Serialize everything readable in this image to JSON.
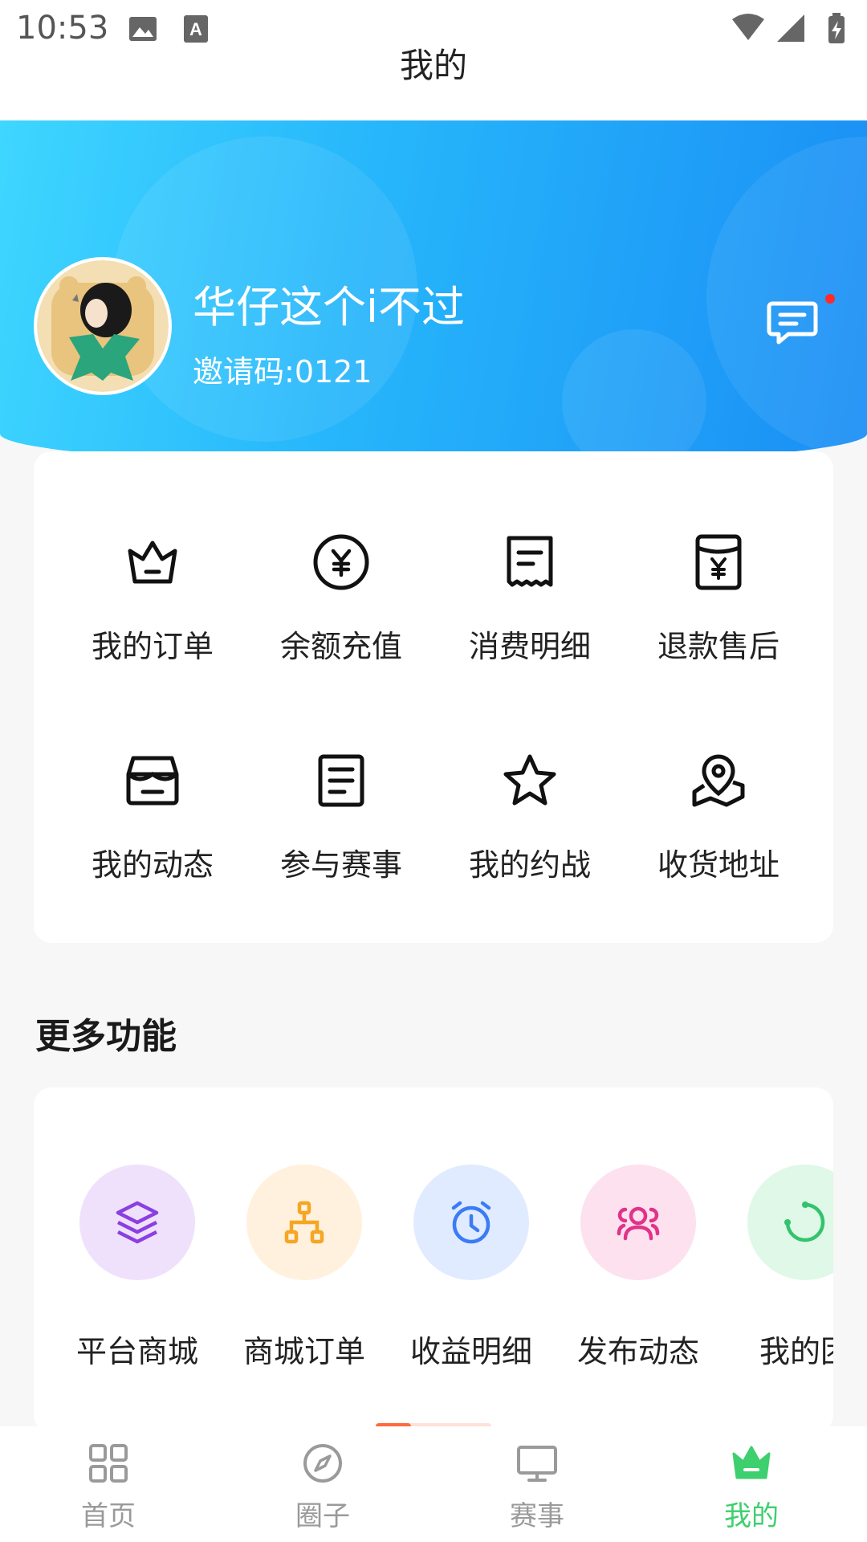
{
  "status_bar": {
    "time": "10:53"
  },
  "header": {
    "title": "我的"
  },
  "profile": {
    "username": "华仔这个i不过",
    "invite_label": "邀请码:",
    "invite_code": "0121",
    "has_unread_messages": true
  },
  "main_grid": [
    {
      "label": "我的订单",
      "icon": "crown-icon"
    },
    {
      "label": "余额充值",
      "icon": "yen-circle-icon"
    },
    {
      "label": "消费明细",
      "icon": "receipt-icon"
    },
    {
      "label": "退款售后",
      "icon": "refund-envelope-icon"
    },
    {
      "label": "我的动态",
      "icon": "store-box-icon"
    },
    {
      "label": "参与赛事",
      "icon": "document-list-icon"
    },
    {
      "label": "我的约战",
      "icon": "star-icon"
    },
    {
      "label": "收货地址",
      "icon": "map-pin-icon"
    }
  ],
  "more": {
    "title": "更多功能",
    "items": [
      {
        "label": "平台商城",
        "icon": "layers-icon",
        "color": "#8b3fe0",
        "bg": "#efe1fb"
      },
      {
        "label": "商城订单",
        "icon": "org-chart-icon",
        "color": "#f5a623",
        "bg": "#fff1de"
      },
      {
        "label": "收益明细",
        "icon": "alarm-clock-icon",
        "color": "#3b7cf5",
        "bg": "#e1ebff"
      },
      {
        "label": "发布动态",
        "icon": "users-icon",
        "color": "#e0338a",
        "bg": "#fde1ee"
      },
      {
        "label": "我的团",
        "icon": "loading-circle-icon",
        "color": "#33c36d",
        "bg": "#dff8e8"
      }
    ],
    "scroll_position": 0.3
  },
  "bottom_nav": [
    {
      "label": "首页",
      "icon": "grid-icon",
      "active": false
    },
    {
      "label": "圈子",
      "icon": "compass-icon",
      "active": false
    },
    {
      "label": "赛事",
      "icon": "monitor-icon",
      "active": false
    },
    {
      "label": "我的",
      "icon": "crown-icon",
      "active": true
    }
  ],
  "colors": {
    "accent_green": "#3ecf6e",
    "hero_blue": "#1a8ef5",
    "scroll_accent": "#ff6a3d"
  }
}
